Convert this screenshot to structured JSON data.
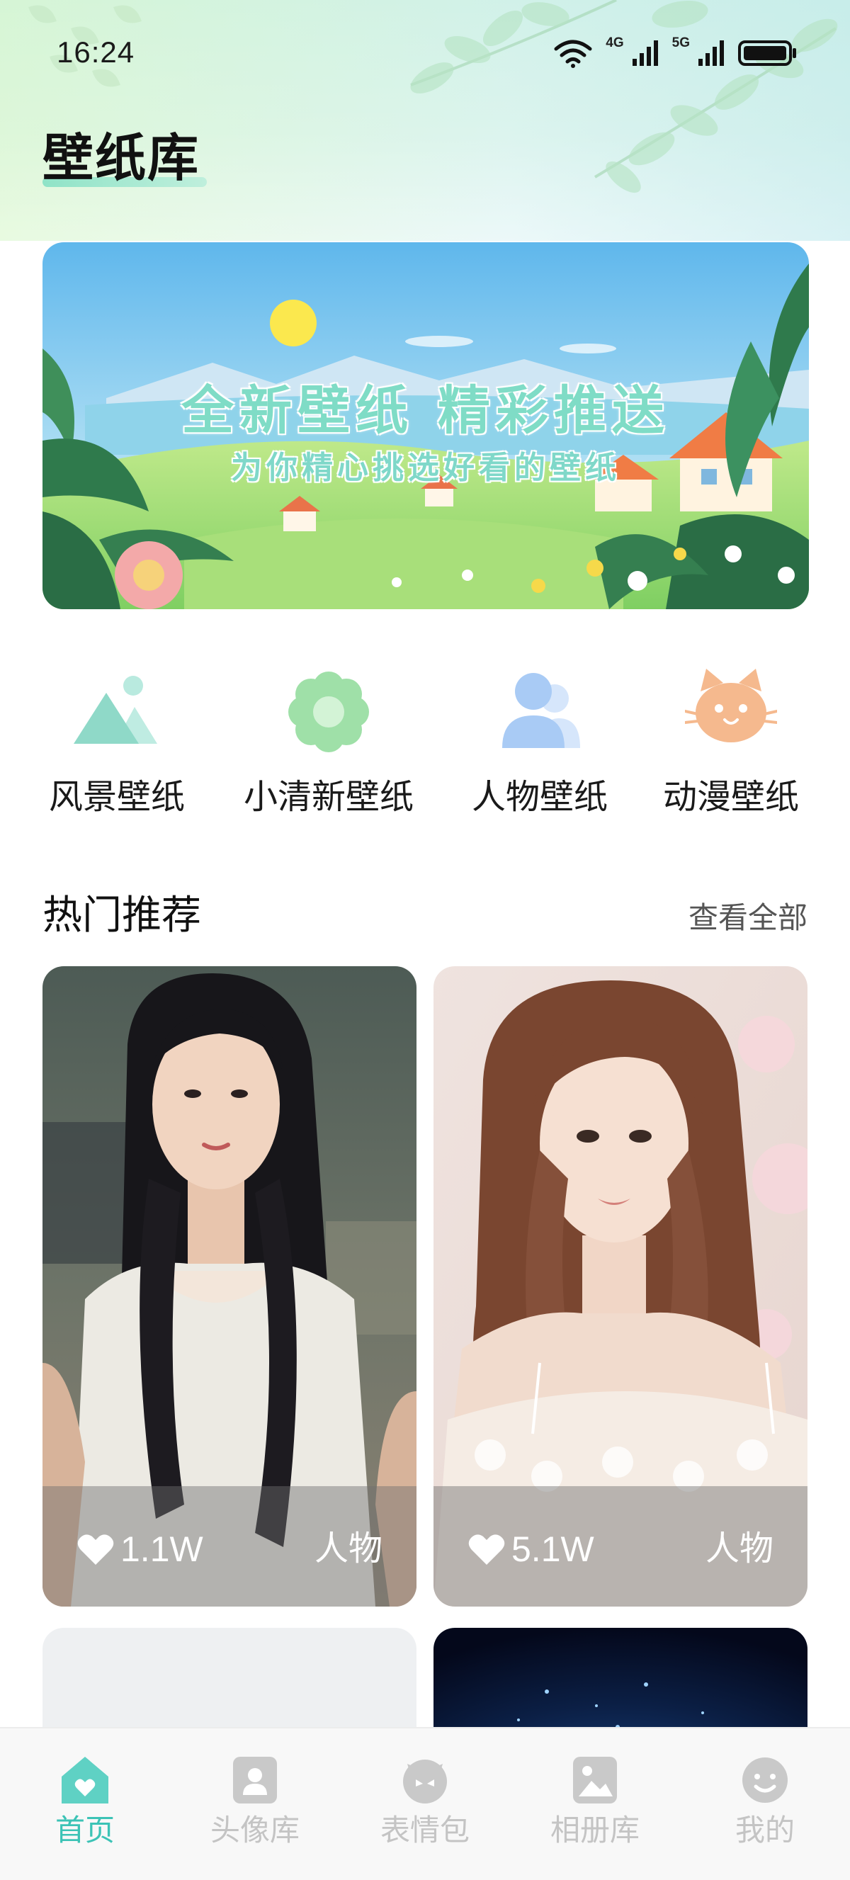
{
  "status_bar": {
    "time": "16:24",
    "network_1": "4G",
    "network_2": "5G"
  },
  "header": {
    "title": "壁纸库"
  },
  "banner": {
    "title": "全新壁纸 精彩推送",
    "subtitle": "为你精心挑选好看的壁纸"
  },
  "categories": [
    {
      "label": "风景壁纸",
      "icon": "mountain-icon",
      "color": "#8fd9c8"
    },
    {
      "label": "小清新壁纸",
      "icon": "flower-icon",
      "color": "#9fe0a8"
    },
    {
      "label": "人物壁纸",
      "icon": "people-icon",
      "color": "#a9cbf5"
    },
    {
      "label": "动漫壁纸",
      "icon": "cat-icon",
      "color": "#f5b98e"
    }
  ],
  "hot_section": {
    "title": "热门推荐",
    "view_all": "查看全部"
  },
  "cards": [
    {
      "likes": "1.1W",
      "tag": "人物"
    },
    {
      "likes": "5.1W",
      "tag": "人物"
    }
  ],
  "tabbar": {
    "active_color": "#3cc3b6",
    "inactive_color": "#c4c4c4",
    "items": [
      {
        "label": "首页",
        "icon": "home-icon",
        "active": true
      },
      {
        "label": "头像库",
        "icon": "avatar-icon",
        "active": false
      },
      {
        "label": "表情包",
        "icon": "emoji-icon",
        "active": false
      },
      {
        "label": "相册库",
        "icon": "album-icon",
        "active": false
      },
      {
        "label": "我的",
        "icon": "profile-icon",
        "active": false
      }
    ]
  }
}
